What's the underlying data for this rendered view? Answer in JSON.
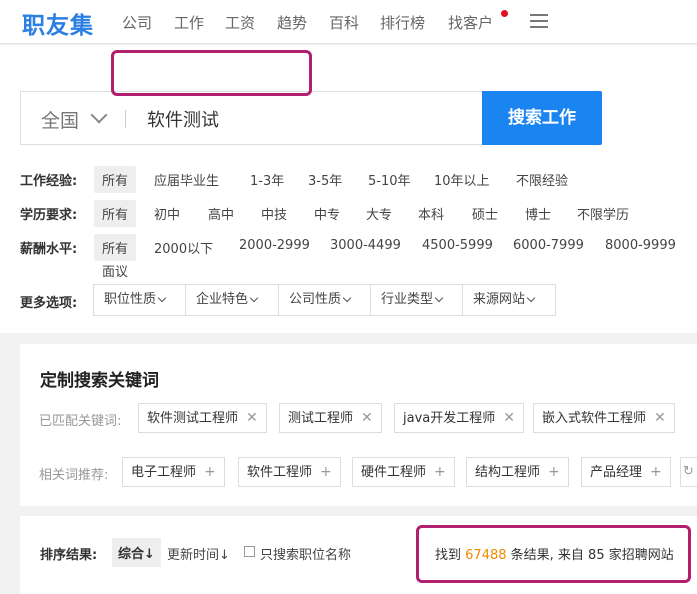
{
  "header": {
    "logo": "职友集",
    "nav": [
      "公司",
      "工作",
      "工资",
      "趋势",
      "百科",
      "排行榜",
      "找客户"
    ]
  },
  "search": {
    "region": "全国",
    "keyword": "软件测试",
    "button": "搜索工作"
  },
  "filters": {
    "experience": {
      "label": "工作经验:",
      "options": [
        "所有",
        "应届毕业生",
        "1-3年",
        "3-5年",
        "5-10年",
        "10年以上",
        "不限经验"
      ]
    },
    "education": {
      "label": "学历要求:",
      "options": [
        "所有",
        "初中",
        "高中",
        "中技",
        "中专",
        "大专",
        "本科",
        "硕士",
        "博士",
        "不限学历"
      ]
    },
    "salary": {
      "label": "薪酬水平:",
      "options": [
        "所有",
        "2000以下",
        "2000-2999",
        "3000-4499",
        "4500-5999",
        "6000-7999",
        "8000-9999",
        "面议"
      ]
    },
    "more": {
      "label": "更多选项:",
      "options": [
        "职位性质",
        "企业特色",
        "公司性质",
        "行业类型",
        "来源网站"
      ]
    }
  },
  "keywords": {
    "title": "定制搜索关键词",
    "matched_label": "已匹配关键词:",
    "matched": [
      "软件测试工程师",
      "测试工程师",
      "java开发工程师",
      "嵌入式软件工程师"
    ],
    "related_label": "相关词推荐:",
    "related": [
      "电子工程师",
      "软件工程师",
      "硬件工程师",
      "结构工程师",
      "产品经理"
    ]
  },
  "results": {
    "sort_label": "排序结果:",
    "sort_default": "综合↓",
    "sort_time": "更新时间↓",
    "only_title": "只搜索职位名称",
    "prefix": "找到",
    "count": "67488",
    "suffix": "条结果, 来自 85 家招聘网站"
  }
}
